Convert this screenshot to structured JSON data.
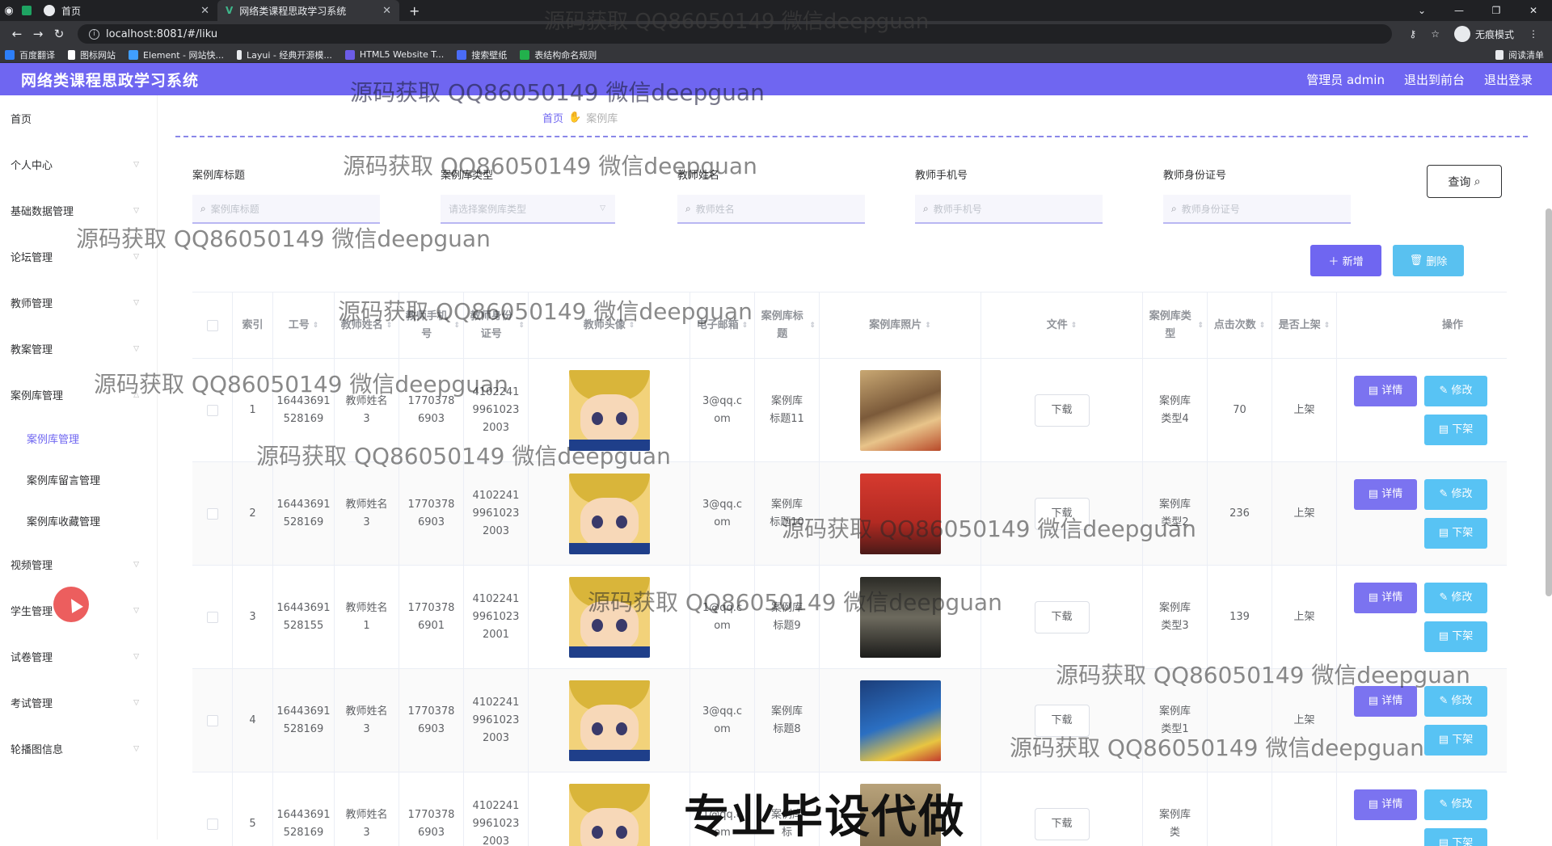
{
  "browser": {
    "tabs": [
      {
        "label": "首页"
      },
      {
        "label": "网络类课程思政学习系统"
      }
    ],
    "url": "localhost:8081/#/liku",
    "incognito_label": "无痕模式",
    "bookmarks": [
      "百度翻译",
      "图标网站",
      "Element - 网站快...",
      "Layui - 经典开源模...",
      "HTML5 Website T...",
      "搜索壁纸",
      "表结构命名规则"
    ],
    "reading_list": "阅读清单"
  },
  "header": {
    "title": "网络类课程思政学习系统",
    "admin": "管理员 admin",
    "to_front": "退出到前台",
    "logout": "退出登录"
  },
  "sidebar": {
    "items": [
      {
        "label": "首页",
        "arrow": false
      },
      {
        "label": "个人中心",
        "arrow": true
      },
      {
        "label": "基础数据管理",
        "arrow": true
      },
      {
        "label": "论坛管理",
        "arrow": true
      },
      {
        "label": "教师管理",
        "arrow": true
      },
      {
        "label": "教案管理",
        "arrow": true
      },
      {
        "label": "案例库管理",
        "arrow": true
      }
    ],
    "subitems": [
      "案例库管理",
      "案例库留言管理",
      "案例库收藏管理"
    ],
    "items_after": [
      {
        "label": "视频管理"
      },
      {
        "label": "学生管理"
      },
      {
        "label": "试卷管理"
      },
      {
        "label": "考试管理"
      },
      {
        "label": "轮播图信息"
      }
    ]
  },
  "breadcrumb": {
    "home": "首页",
    "current": "案例库"
  },
  "search": {
    "fields": [
      {
        "label": "案例库标题",
        "placeholder": "案例库标题"
      },
      {
        "label": "案例库类型",
        "placeholder": "请选择案例库类型"
      },
      {
        "label": "教师姓名",
        "placeholder": "教师姓名"
      },
      {
        "label": "教师手机号",
        "placeholder": "教师手机号"
      },
      {
        "label": "教师身份证号",
        "placeholder": "教师身份证号"
      }
    ],
    "query_label": "查询"
  },
  "actions": {
    "add": "新增",
    "delete": "删除"
  },
  "table": {
    "headers": [
      "索引",
      "工号",
      "教师姓名",
      "教师手机号",
      "教师身份证号",
      "教师头像",
      "电子邮箱",
      "案例库标题",
      "案例库照片",
      "文件",
      "案例库类型",
      "点击次数",
      "是否上架",
      "操作"
    ],
    "rows": [
      {
        "index": "1",
        "job": "16443691528169",
        "name": "教师姓名3",
        "phone": "17703786903",
        "idcard": "410224199610232003",
        "email": "3@qq.com",
        "title": "案例库标题11",
        "file": "下载",
        "type": "案例库类型4",
        "clicks": "70",
        "status": "上架"
      },
      {
        "index": "2",
        "job": "16443691528169",
        "name": "教师姓名3",
        "phone": "17703786903",
        "idcard": "410224199610232003",
        "email": "3@qq.com",
        "title": "案例库标题10",
        "file": "下载",
        "type": "案例库类型2",
        "clicks": "236",
        "status": "上架"
      },
      {
        "index": "3",
        "job": "16443691528155",
        "name": "教师姓名1",
        "phone": "17703786901",
        "idcard": "410224199610232001",
        "email": "1@qq.com",
        "title": "案例库标题9",
        "file": "下载",
        "type": "案例库类型3",
        "clicks": "139",
        "status": "上架"
      },
      {
        "index": "4",
        "job": "16443691528169",
        "name": "教师姓名3",
        "phone": "17703786903",
        "idcard": "410224199610232003",
        "email": "3@qq.com",
        "title": "案例库标题8",
        "file": "下载",
        "type": "案例库类型1",
        "clicks": "",
        "status": "上架"
      },
      {
        "index": "5",
        "job": "16443691528169",
        "name": "教师姓名3",
        "phone": "17703786903",
        "idcard": "410224199610232003",
        "email": "1@qq.com",
        "title": "案例库标",
        "file": "下载",
        "type": "案例库类",
        "clicks": "",
        "status": ""
      }
    ],
    "op_detail": "详情",
    "op_edit": "修改",
    "op_down": "下架"
  },
  "watermark": "源码获取 QQ86050149 微信deepguan",
  "banner": "专业毕设代做",
  "colors": {
    "accent": "#6f66f1",
    "info": "#58c3f4"
  }
}
